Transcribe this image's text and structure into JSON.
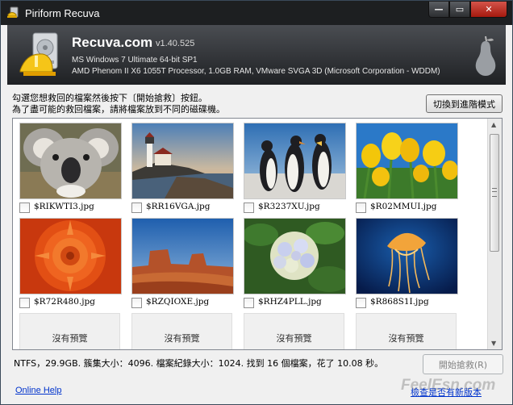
{
  "window": {
    "title": "Piriform Recuva",
    "minimize_glyph": "—",
    "maximize_glyph": "▭",
    "close_glyph": "✕"
  },
  "header": {
    "app_name": "Recuva.com",
    "version": "v1.40.525",
    "os_line": "MS Windows 7 Ultimate 64-bit SP1",
    "hw_line": "AMD Phenom II X6 1055T Processor, 1.0GB RAM, VMware SVGA 3D (Microsoft Corporation - WDDM)"
  },
  "instructions": {
    "line1": "勾選您想救回的檔案然後按下〔開始搶救〕按鈕。",
    "line2": "為了盡可能的救回檔案，請將檔案放到不同的磁碟機。",
    "advanced_button": "切換到進階模式"
  },
  "files": [
    {
      "name": "$RIKWTI3.jpg",
      "checked": false,
      "picture": "koala"
    },
    {
      "name": "$RR16VGA.jpg",
      "checked": false,
      "picture": "lighthouse"
    },
    {
      "name": "$R3237XU.jpg",
      "checked": false,
      "picture": "penguins"
    },
    {
      "name": "$R02MMUI.jpg",
      "checked": false,
      "picture": "tulips"
    },
    {
      "name": "$R72R480.jpg",
      "checked": false,
      "picture": "chrysanthemum"
    },
    {
      "name": "$RZQIOXE.jpg",
      "checked": false,
      "picture": "desert"
    },
    {
      "name": "$RHZ4PLL.jpg",
      "checked": false,
      "picture": "hydrangeas"
    },
    {
      "name": "$R868S1I.jpg",
      "checked": false,
      "picture": "jellyfish"
    }
  ],
  "no_preview_label": "沒有預覽",
  "status_bar": {
    "text": "NTFS，29.9GB. 簇集大小：4096. 檔案紀錄大小：1024. 找到 16 個檔案，花了 10.08 秒。",
    "recover_button": "開始搶救(R)"
  },
  "footer": {
    "online_help": "Online Help",
    "check_updates": "檢查是否有新版本",
    "watermark": "FeelEsn.com"
  },
  "colors": {
    "titlebar": "#1d1f21",
    "header_top": "#4a4d52",
    "header_bottom": "#1f2124",
    "link": "#0033cc"
  },
  "scrollbar": {
    "position_fraction": 0.0,
    "visible_fraction": 0.55
  }
}
